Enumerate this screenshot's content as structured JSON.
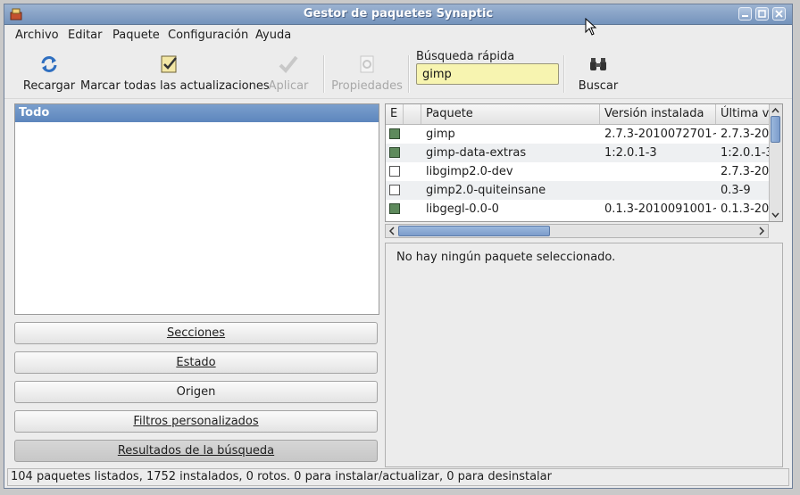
{
  "window": {
    "title": "Gestor de paquetes Synaptic"
  },
  "menu": [
    {
      "label": "Archivo"
    },
    {
      "label": "Editar"
    },
    {
      "label": "Paquete"
    },
    {
      "label": "Configuración"
    },
    {
      "label": "Ayuda"
    }
  ],
  "toolbar": {
    "reload_label": "Recargar",
    "mark_all_label": "Marcar todas las actualizaciones",
    "apply_label": "Aplicar",
    "properties_label": "Propiedades",
    "search_label": "Buscar"
  },
  "quick_search": {
    "label": "Búsqueda rápida",
    "value": "gimp"
  },
  "left_panel": {
    "header": "Todo",
    "buttons": {
      "sections": "Secciones",
      "status": "Estado",
      "origin": "Origen",
      "custom_filters": "Filtros personalizados",
      "search_results": "Resultados de la búsqueda"
    }
  },
  "table": {
    "headers": {
      "status": "E",
      "package": "Paquete",
      "installed": "Versión instalada",
      "latest": "Última ve"
    },
    "rows": [
      {
        "installed_flag": true,
        "name": "gimp",
        "installed": "2.7.3-2010072701~",
        "latest": "2.7.3-20"
      },
      {
        "installed_flag": true,
        "name": "gimp-data-extras",
        "installed": "1:2.0.1-3",
        "latest": "1:2.0.1-3"
      },
      {
        "installed_flag": false,
        "name": "libgimp2.0-dev",
        "installed": "",
        "latest": "2.7.3-20"
      },
      {
        "installed_flag": false,
        "name": "gimp2.0-quiteinsane",
        "installed": "",
        "latest": "0.3-9"
      },
      {
        "installed_flag": true,
        "name": "libgegl-0.0-0",
        "installed": "0.1.3-2010091001~",
        "latest": "0.1.3-20"
      }
    ]
  },
  "detail": {
    "text": "No hay ningún paquete seleccionado."
  },
  "status_bar": {
    "text": "104 paquetes listados, 1752 instalados, 0 rotos. 0 para instalar/actualizar, 0 para desinstalar"
  },
  "colors": {
    "title_bar": "#7f9cc3",
    "selection": "#6a91c6",
    "installed": "#5e8a5c",
    "search_bg": "#f7f4b0"
  },
  "icons": [
    "synaptic-app-icon",
    "minimize-icon",
    "maximize-icon",
    "close-icon",
    "reload-icon",
    "mark-upgrades-icon",
    "apply-icon",
    "properties-icon",
    "binoculars-icon"
  ]
}
